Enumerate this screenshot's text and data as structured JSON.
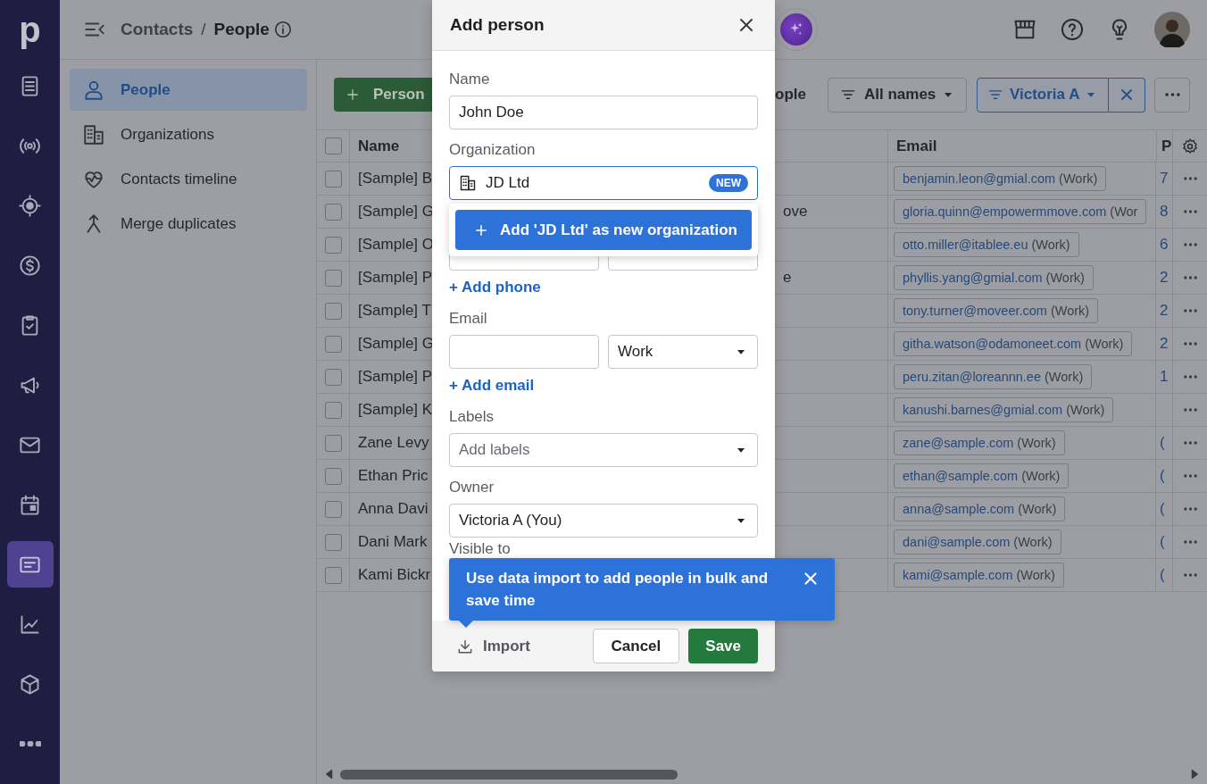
{
  "rail": {
    "logo": "p",
    "items": [
      {
        "kind": "doc",
        "selected": false
      },
      {
        "kind": "broadcast",
        "selected": false
      },
      {
        "kind": "target",
        "selected": false
      },
      {
        "kind": "dollar",
        "selected": false
      },
      {
        "kind": "clipboard",
        "selected": false
      },
      {
        "kind": "megaphone",
        "selected": false
      },
      {
        "kind": "mail",
        "selected": false
      },
      {
        "kind": "calendar",
        "selected": false
      },
      {
        "kind": "card",
        "selected": true
      },
      {
        "kind": "chart",
        "selected": false
      },
      {
        "kind": "box",
        "selected": false
      },
      {
        "kind": "more",
        "selected": false
      }
    ]
  },
  "top_bar": {
    "breadcrumb_parent": "Contacts",
    "breadcrumb_separator": "/",
    "breadcrumb_current": "People"
  },
  "subnav": {
    "items": [
      {
        "kind": "person",
        "label": "People",
        "selected": true
      },
      {
        "kind": "building",
        "label": "Organizations",
        "selected": false
      },
      {
        "kind": "heart",
        "label": "Contacts timeline",
        "selected": false
      },
      {
        "kind": "merge",
        "label": "Merge duplicates",
        "selected": false
      }
    ]
  },
  "toolbar": {
    "add_button": "Person",
    "count_text": "ople",
    "name_filter": "All names",
    "owner_filter": "Victoria A"
  },
  "table": {
    "select_all": {
      "checked": false
    },
    "columns": [
      {
        "label": "Name"
      },
      {
        "label": "Email"
      },
      {
        "label": "P"
      }
    ],
    "rows": [
      {
        "checked": false,
        "name": "[Sample] B",
        "email": "benjamin.leon@gmial.com",
        "email_type": "(Work)",
        "phone": "7"
      },
      {
        "checked": false,
        "name": "[Sample] G",
        "column_3": "ove",
        "email": "gloria.quinn@empowermmove.com",
        "email_type": "(Wor",
        "phone": "8"
      },
      {
        "checked": false,
        "name": "[Sample] O",
        "email": "otto.miller@itablee.eu",
        "email_type": "(Work)",
        "phone": "6"
      },
      {
        "checked": false,
        "name": "[Sample] P",
        "column_3": "e",
        "email": "phyllis.yang@gmial.com",
        "email_type": "(Work)",
        "phone": "2"
      },
      {
        "checked": false,
        "name": "[Sample] T",
        "email": "tony.turner@moveer.com",
        "email_type": "(Work)",
        "phone": "2"
      },
      {
        "checked": false,
        "name": "[Sample] G",
        "email": "githa.watson@odamoneet.com",
        "email_type": "(Work)",
        "phone": "2"
      },
      {
        "checked": false,
        "name": "[Sample] P",
        "email": "peru.zitan@loreannn.ee",
        "email_type": "(Work)",
        "phone": "1"
      },
      {
        "checked": false,
        "name": "[Sample] K",
        "email": "kanushi.barnes@gmial.com",
        "email_type": "(Work)"
      },
      {
        "checked": false,
        "name": "Zane Levy",
        "email": "zane@sample.com",
        "email_type": "(Work)",
        "phone": "("
      },
      {
        "checked": false,
        "name": "Ethan Pric",
        "email": "ethan@sample.com",
        "email_type": "(Work)",
        "phone": "("
      },
      {
        "checked": false,
        "name": "Anna Davi",
        "email": "anna@sample.com",
        "email_type": "(Work)",
        "phone": "("
      },
      {
        "checked": false,
        "name": "Dani Mark",
        "email": "dani@sample.com",
        "email_type": "(Work)",
        "phone": "("
      },
      {
        "checked": false,
        "name": "Kami Bickr",
        "email": "kami@sample.com",
        "email_type": "(Work)",
        "phone": "("
      }
    ]
  },
  "modal": {
    "title": "Add person",
    "fields": [
      {
        "kind": "text",
        "label": "Name",
        "value": "John Doe"
      },
      {
        "kind": "organization",
        "label": "Organization",
        "value": "JD Ltd",
        "badge": "NEW",
        "focused": true
      },
      {
        "kind": "pair"
      },
      {
        "kind": "link",
        "text": "+ Add phone"
      },
      {
        "kind": "pair",
        "label": "Email",
        "type": "Work"
      },
      {
        "kind": "link",
        "text": "+ Add email"
      },
      {
        "kind": "select",
        "label": "Labels",
        "placeholder": "Add labels"
      },
      {
        "kind": "select",
        "label": "Owner",
        "value": "Victoria A (You)"
      },
      {
        "kind": "label",
        "label": "Visible to"
      }
    ],
    "suggestion": "Add 'JD Ltd' as new organization",
    "import_button": "Import",
    "cancel_button": "Cancel",
    "save_button": "Save"
  },
  "tooltip": {
    "text": "Use data import to add people in bulk and save time"
  }
}
